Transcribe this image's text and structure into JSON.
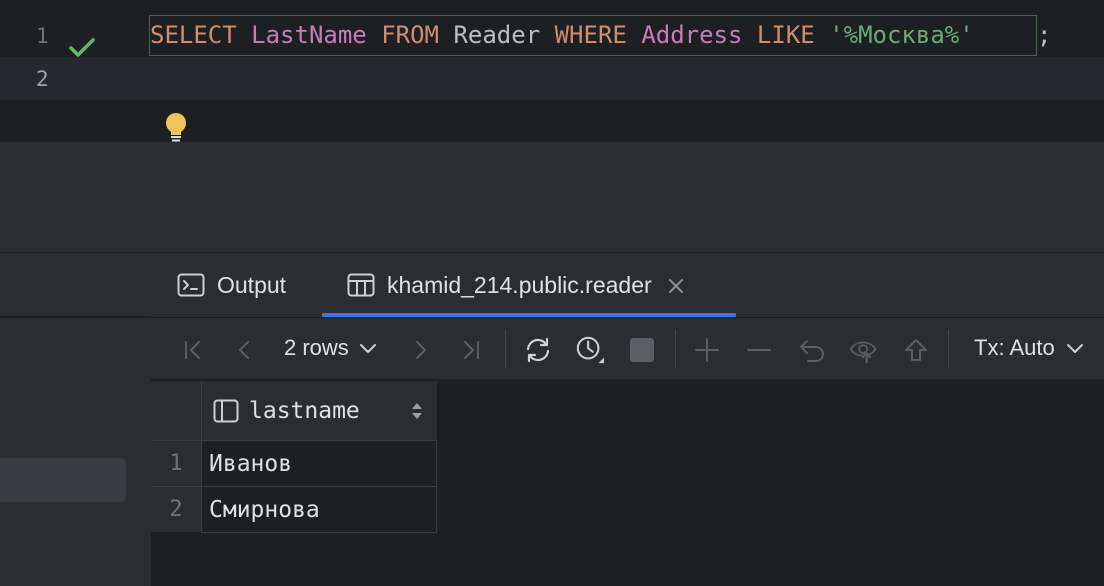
{
  "editor": {
    "lines": [
      {
        "number": "1",
        "status": "check-icon"
      },
      {
        "number": "2"
      }
    ],
    "code": {
      "kw_select": "SELECT",
      "ident_lastname": "LastName",
      "kw_from": "FROM",
      "table": "Reader",
      "kw_where": "WHERE",
      "ident_address": "Address",
      "kw_like": "LIKE",
      "string": "'%Москва%'",
      "semicolon": ";"
    }
  },
  "tool_window": {
    "tabs": [
      {
        "label": "Output",
        "icon": "console-icon",
        "active": false
      },
      {
        "label": "khamid_214.public.reader",
        "icon": "table-icon",
        "active": true
      }
    ]
  },
  "toolbar": {
    "rows_label": "2 rows",
    "tx_label": "Tx: Auto"
  },
  "grid": {
    "columns": [
      "lastname"
    ],
    "rows": [
      {
        "num": "1",
        "lastname": "Иванов"
      },
      {
        "num": "2",
        "lastname": "Смирнова"
      }
    ]
  },
  "colors": {
    "accent": "#3574f0",
    "keyword": "#cf8e6d",
    "identifier": "#c77dbb",
    "string": "#6aab73",
    "success": "#5fb865",
    "bulb": "#f2c55c"
  }
}
